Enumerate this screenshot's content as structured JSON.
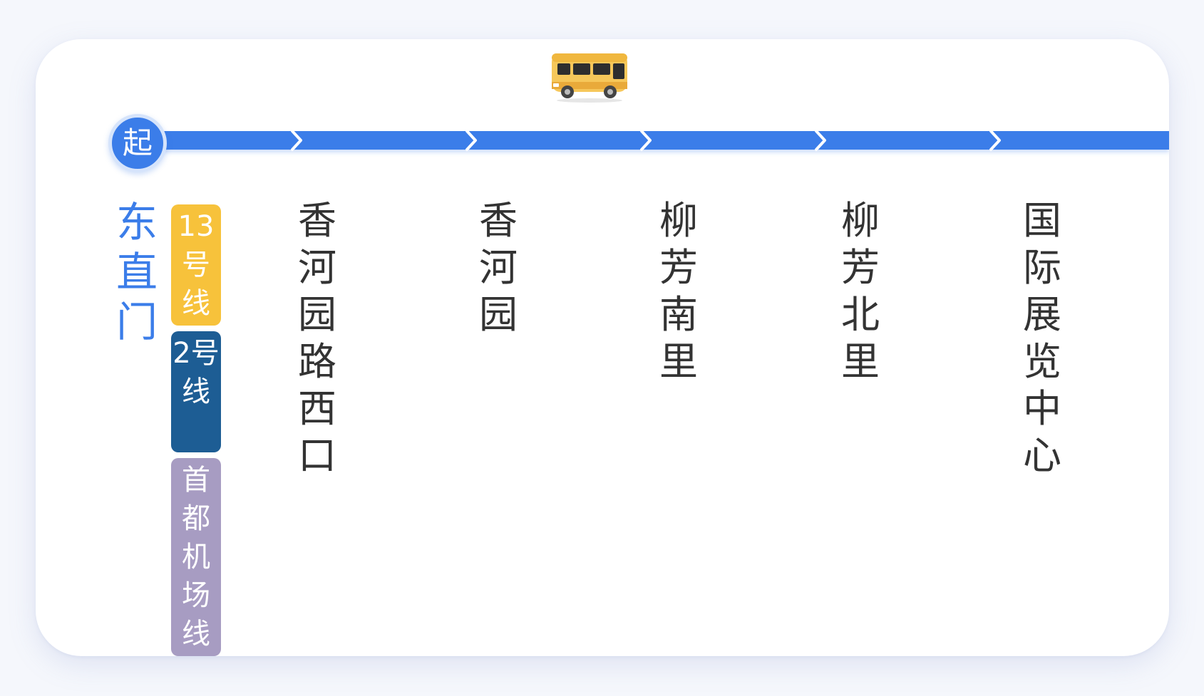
{
  "route": {
    "start_badge": "起",
    "start_station": "东直门",
    "transfer_lines": [
      {
        "label": "13号线",
        "color": "#f7c23b"
      },
      {
        "label": "2号线",
        "color": "#1d5d94"
      },
      {
        "label": "首都机场线",
        "color": "#a79cc2"
      }
    ],
    "stops": [
      "香河园路西口",
      "香河园",
      "柳芳南里",
      "柳芳北里",
      "国际展览中心"
    ],
    "line_color": "#3b7de9",
    "bus_icon": "bus-icon"
  }
}
